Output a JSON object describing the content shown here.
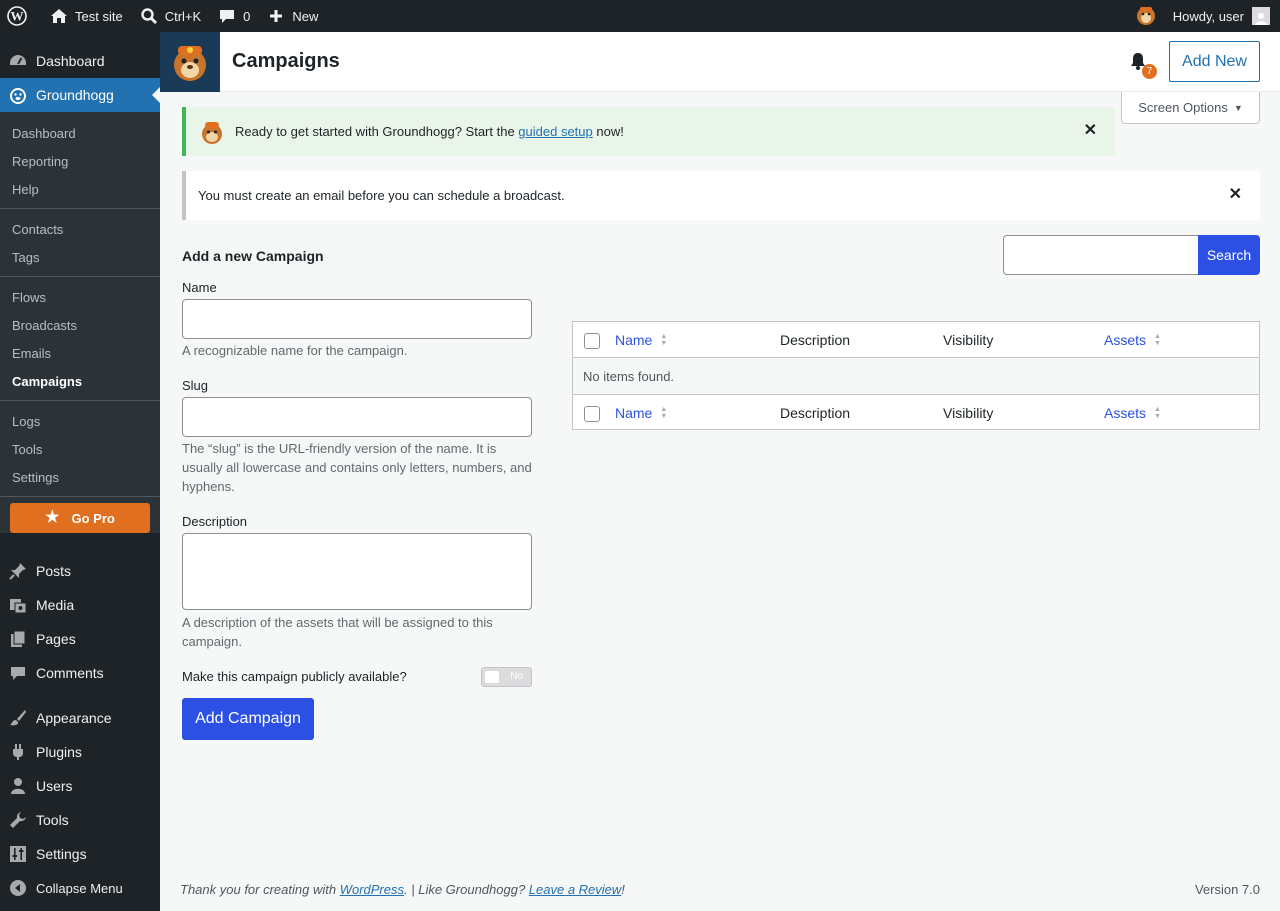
{
  "admin_bar": {
    "site_name": "Test site",
    "search_shortcut": "Ctrl+K",
    "comments_count": "0",
    "new_label": "New",
    "greeting": "Howdy, user"
  },
  "sidebar": {
    "top_items": [
      {
        "label": "Dashboard",
        "icon": "dashboard-icon"
      },
      {
        "label": "Groundhogg",
        "icon": "groundhogg-icon"
      }
    ],
    "sub_groups": [
      [
        "Dashboard",
        "Reporting",
        "Help"
      ],
      [
        "Contacts",
        "Tags"
      ],
      [
        "Flows",
        "Broadcasts",
        "Emails",
        "Campaigns"
      ],
      [
        "Logs",
        "Tools",
        "Settings"
      ]
    ],
    "current_sub": "Campaigns",
    "go_pro": "Go Pro",
    "bottom_items": [
      "Posts",
      "Media",
      "Pages",
      "Comments",
      "Appearance",
      "Plugins",
      "Users",
      "Tools",
      "Settings",
      "Collapse Menu"
    ]
  },
  "header": {
    "title": "Campaigns",
    "notification_count": "7",
    "add_new": "Add New",
    "screen_options": "Screen Options"
  },
  "notices": {
    "guided_before": "Ready to get started with Groundhogg? Start the ",
    "guided_link": "guided setup",
    "guided_after": " now!",
    "email_required": "You must create an email before you can schedule a broadcast."
  },
  "form": {
    "title": "Add a new Campaign",
    "name_label": "Name",
    "name_help": "A recognizable name for the campaign.",
    "slug_label": "Slug",
    "slug_help": "The “slug” is the URL-friendly version of the name. It is usually all lowercase and contains only letters, numbers, and hyphens.",
    "description_label": "Description",
    "description_help": "A description of the assets that will be assigned to this campaign.",
    "public_label": "Make this campaign publicly available?",
    "public_toggle": "No",
    "submit": "Add Campaign"
  },
  "search": {
    "button": "Search"
  },
  "table": {
    "columns": [
      "Name",
      "Description",
      "Visibility",
      "Assets"
    ],
    "empty": "No items found."
  },
  "footer": {
    "thanks_before": "Thank you for creating with ",
    "wordpress_link": "WordPress",
    "thanks_middle": ". | Like Groundhogg? ",
    "review_link": "Leave a Review",
    "thanks_after": "!",
    "version": "Version 7.0"
  },
  "colors": {
    "primary_blue": "#2b50e3",
    "wp_blue": "#2271b1",
    "orange": "#e0701f",
    "success_green": "#3fb556"
  }
}
